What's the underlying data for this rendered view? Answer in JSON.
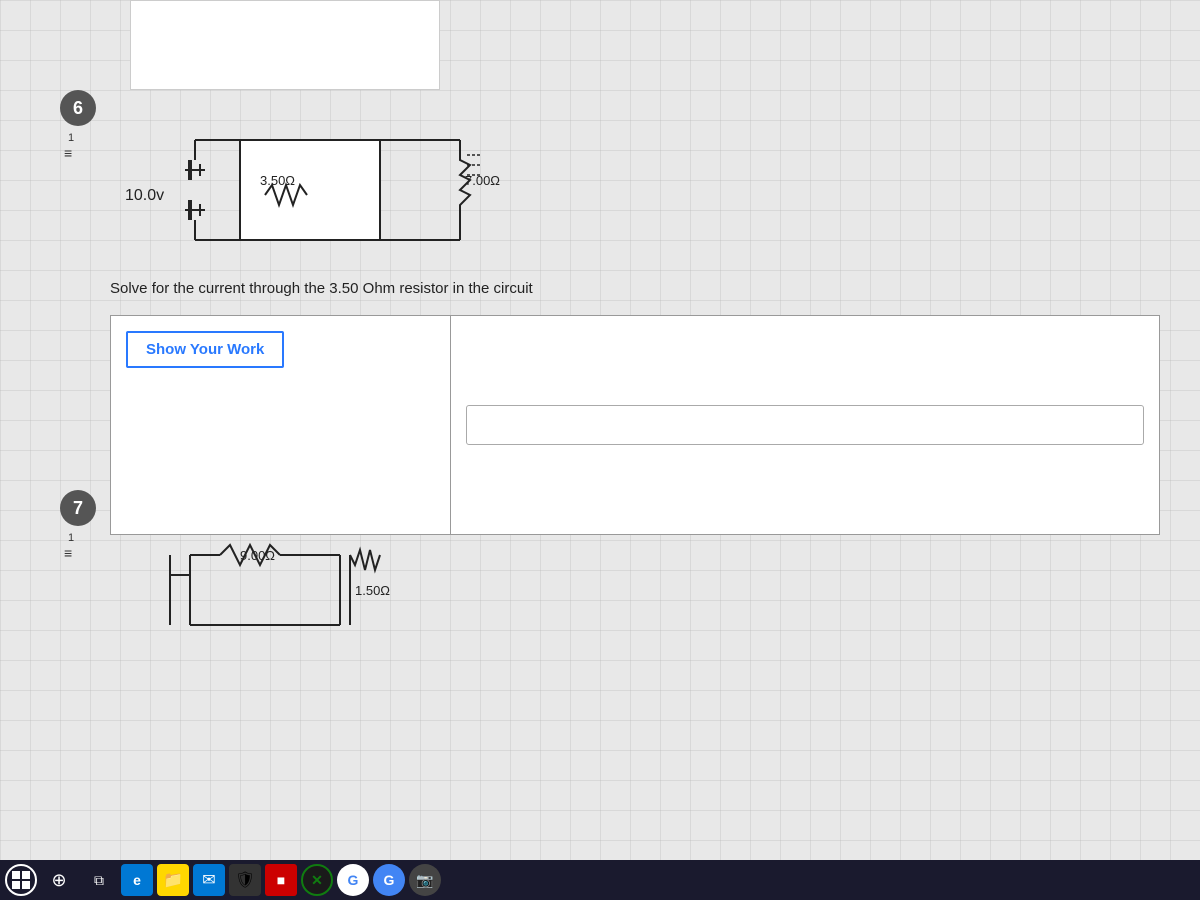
{
  "page": {
    "background_color": "#d0d0d0"
  },
  "question6": {
    "number": "6",
    "sub_label": "1",
    "circuit": {
      "voltage": "10.0v",
      "resistor1_label": "3.50Ω",
      "resistor2_label": "7.00Ω"
    },
    "problem_text": "Solve for the current through the 3.50 Ohm resistor in the circuit",
    "show_work_btn_label": "Show Your Work",
    "answer_placeholder": ""
  },
  "question7": {
    "number": "7",
    "sub_label": "1",
    "circuit": {
      "resistor1_label": "9.00Ω",
      "resistor2_label": "1.50Ω"
    }
  },
  "taskbar": {
    "items": [
      {
        "name": "start",
        "symbol": "⊞"
      },
      {
        "name": "search",
        "symbol": "🔍"
      },
      {
        "name": "task-view",
        "symbol": "⧉"
      },
      {
        "name": "edge",
        "symbol": "e"
      },
      {
        "name": "file-explorer",
        "symbol": "📁"
      },
      {
        "name": "mail",
        "symbol": "✉"
      },
      {
        "name": "security",
        "symbol": "🛡"
      },
      {
        "name": "red-app",
        "symbol": "■"
      },
      {
        "name": "xbox",
        "symbol": "X"
      },
      {
        "name": "google",
        "symbol": "G"
      },
      {
        "name": "google2",
        "symbol": "G"
      },
      {
        "name": "camera",
        "symbol": "📷"
      }
    ]
  }
}
